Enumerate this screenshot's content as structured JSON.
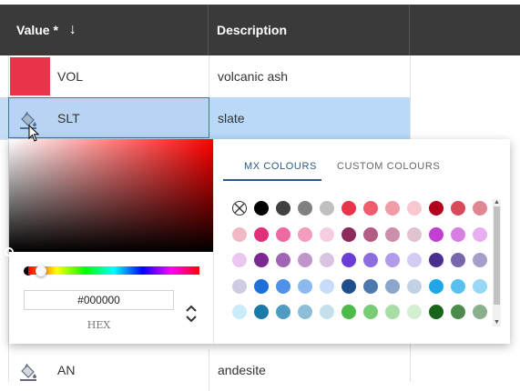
{
  "table": {
    "headers": {
      "value": "Value *",
      "description": "Description"
    },
    "rows": [
      {
        "value": "VOL",
        "description": "volcanic ash",
        "swatch_color": "#e8334a"
      },
      {
        "value": "SLT",
        "description": "slate",
        "icon": "paint-bucket-icon"
      },
      {
        "value": "AN",
        "description": "andesite",
        "icon": "paint-bucket-icon"
      }
    ]
  },
  "picker": {
    "hex_value": "#000000",
    "hex_label": "HEX",
    "tabs": [
      "MX COLOURS",
      "CUSTOM COLOURS"
    ],
    "active_tab": "MX COLOURS",
    "palette": [
      [
        "none",
        "#000000",
        "#404040",
        "#808080",
        "#bfbfbf",
        "#e8334a",
        "#f25a6e",
        "#f29ca7",
        "#f8c7cf",
        "#b3001f",
        "#d84a5a",
        "#e08693"
      ],
      [
        "#f0b9c6",
        "#e0307a",
        "#ee6aa2",
        "#f29cc0",
        "#f6cde0",
        "#8c2a5c",
        "#b35c85",
        "#cc8fac",
        "#e0c2d1",
        "#c23fd4",
        "#d77fe3",
        "#e6b0ee"
      ],
      [
        "#e9c7ef",
        "#7b2890",
        "#a064b2",
        "#bf95cc",
        "#d9c3e2",
        "#6a3dd6",
        "#8d6cdf",
        "#b09cea",
        "#d4cbf4",
        "#4a2f8f",
        "#7866ad",
        "#a79dcb"
      ],
      [
        "#cfcbe3",
        "#1e6fd9",
        "#4f91e6",
        "#8cb9f0",
        "#c6dcf8",
        "#1f4e8c",
        "#4f78ad",
        "#8aa6ca",
        "#c2d2e5",
        "#1fa6e8",
        "#58c0ef",
        "#96d8f5"
      ],
      [
        "#c9ebfa",
        "#1b79a8",
        "#4f9bc2",
        "#8cbed8",
        "#c5dfec",
        "#4dbb4a",
        "#78cc75",
        "#a8dda5",
        "#d3eed1",
        "#17641a",
        "#4c8a4e",
        "#8aaf8b"
      ]
    ]
  },
  "colors": {
    "header_bg": "#3a3a3a",
    "selection_bg": "#b9d4f2",
    "accent": "#2b5a8a"
  }
}
